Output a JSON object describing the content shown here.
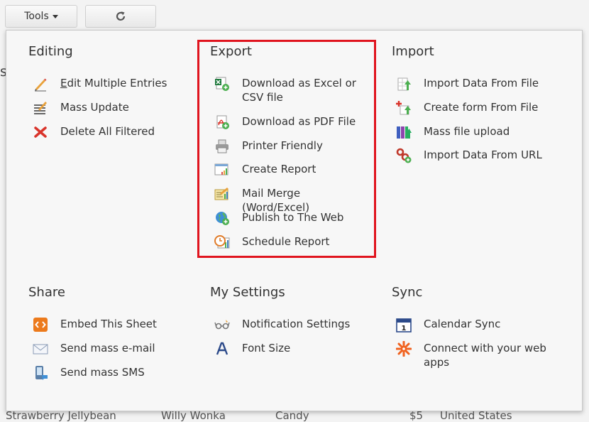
{
  "toolbar": {
    "tools_label": "Tools",
    "refresh_icon": "refresh-icon"
  },
  "background": {
    "heading_fragment": "s",
    "row": [
      "Strawberry Jellybean",
      "Willy Wonka",
      "Candy",
      "$5",
      "United States"
    ]
  },
  "menu": {
    "editing": {
      "title": "Editing",
      "items": [
        {
          "label_first": "E",
          "label_rest": "dit Multiple Entries",
          "icon": "pencil-icon"
        },
        {
          "label": "Mass Update",
          "icon": "mass-update-icon"
        },
        {
          "label": "Delete All Filtered",
          "icon": "delete-x-icon"
        }
      ]
    },
    "export": {
      "title": "Export",
      "items": [
        {
          "label": "Download as Excel or CSV file",
          "icon": "excel-icon"
        },
        {
          "label": "Download as PDF File",
          "icon": "pdf-icon"
        },
        {
          "label": "Printer Friendly",
          "icon": "printer-icon"
        },
        {
          "label": "Create Report",
          "icon": "report-icon"
        },
        {
          "label": "Mail Merge (Word/Excel)",
          "icon": "mail-merge-icon"
        },
        {
          "label": "Publish to The Web",
          "icon": "globe-icon"
        },
        {
          "label": "Schedule Report",
          "icon": "schedule-report-icon"
        }
      ],
      "highlight_color": "#e0141e"
    },
    "import": {
      "title": "Import",
      "items": [
        {
          "label": "Import Data From File",
          "icon": "import-file-icon"
        },
        {
          "label": "Create form From File",
          "icon": "create-form-icon"
        },
        {
          "label": "Mass file upload",
          "icon": "mass-upload-icon"
        },
        {
          "label": "Import Data From URL",
          "icon": "url-link-icon"
        }
      ]
    },
    "share": {
      "title": "Share",
      "items": [
        {
          "label": "Embed This Sheet",
          "icon": "embed-code-icon"
        },
        {
          "label": "Send mass e-mail",
          "icon": "email-icon"
        },
        {
          "label": "Send mass SMS",
          "icon": "sms-phone-icon"
        }
      ]
    },
    "my_settings": {
      "title": "My Settings",
      "items": [
        {
          "label": "Notification Settings",
          "icon": "glasses-icon"
        },
        {
          "label": "Font Size",
          "icon": "font-a-icon"
        }
      ]
    },
    "sync": {
      "title": "Sync",
      "items": [
        {
          "label": "Calendar Sync",
          "icon": "calendar-icon"
        },
        {
          "label": "Connect with your web apps",
          "icon": "gear-burst-icon"
        }
      ]
    }
  }
}
